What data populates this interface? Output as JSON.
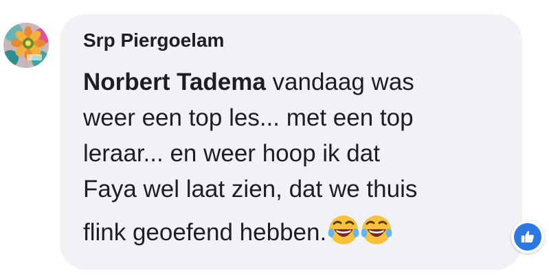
{
  "comment": {
    "author": "Srp Piergoelam",
    "mention": "Norbert Tadema",
    "lines": [
      " vandaag was",
      "weer een top les... met een top",
      "leraar... en weer hoop ik dat",
      "Faya wel laat zien, dat we thuis",
      "flink geoefend hebben."
    ],
    "emojis": [
      "laughing-crying-emoji",
      "laughing-crying-emoji"
    ]
  },
  "reactions": {
    "icon": "thumbs-up-icon",
    "color": "#2b78e4"
  }
}
